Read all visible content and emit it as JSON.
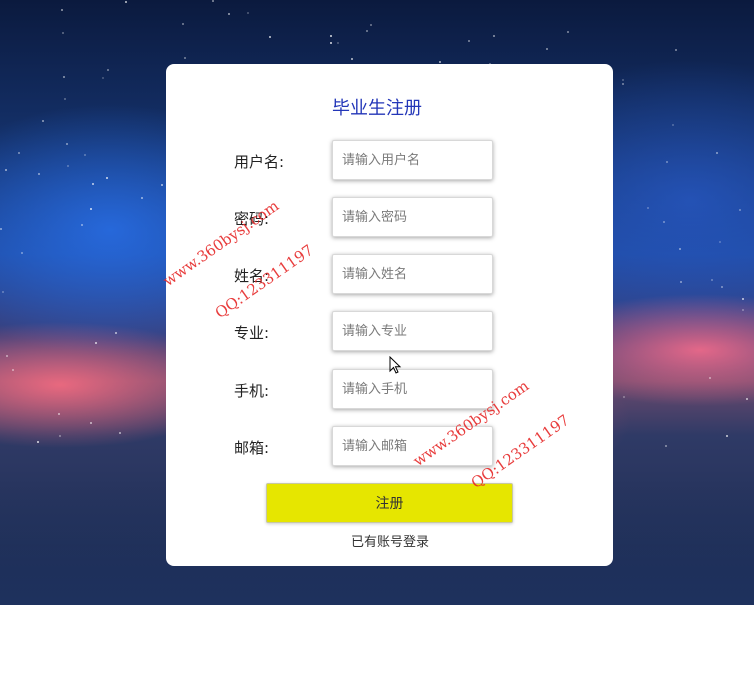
{
  "form": {
    "title": "毕业生注册",
    "fields": [
      {
        "label": "用户名:",
        "placeholder": "请输入用户名",
        "value": ""
      },
      {
        "label": "密码:",
        "placeholder": "请输入密码",
        "value": ""
      },
      {
        "label": "姓名:",
        "placeholder": "请输入姓名",
        "value": ""
      },
      {
        "label": "专业:",
        "placeholder": "请输入专业",
        "value": ""
      },
      {
        "label": "手机:",
        "placeholder": "请输入手机",
        "value": ""
      },
      {
        "label": "邮箱:",
        "placeholder": "请输入邮箱",
        "value": ""
      }
    ],
    "submit_label": "注册",
    "login_link": "已有账号登录"
  },
  "watermarks": {
    "site_1": "www.360bysj.com",
    "qq_1": "QQ:123311197",
    "site_2": "www.360bysj.com",
    "qq_2": "QQ:123311197"
  },
  "colors": {
    "title": "#2336b8",
    "submit_bg": "#e6e600",
    "watermark": "#e62828"
  }
}
